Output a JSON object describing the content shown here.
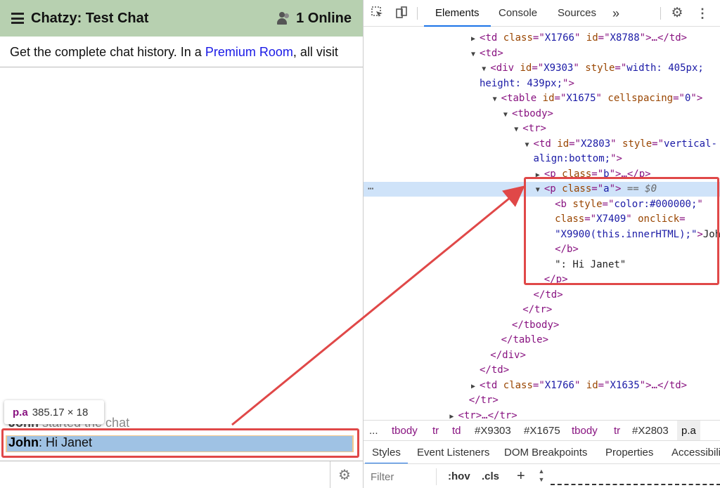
{
  "chat": {
    "title": "Chatzy: Test Chat",
    "online": "1 Online",
    "banner_pre": "Get the complete chat history. In a ",
    "banner_link": "Premium Room",
    "banner_post": ", all visit",
    "tooltip_tag": "p.a",
    "tooltip_size": "385.17 × 18",
    "msg1_user": "John",
    "msg1_text": " started the chat",
    "msg2_user": "John",
    "msg2_text": ": Hi Janet"
  },
  "devtools": {
    "tabs": [
      "Elements",
      "Console",
      "Sources",
      "»"
    ],
    "dom": [
      {
        "indent": 10,
        "tri": "▶",
        "parts": [
          [
            "tag",
            "<td "
          ],
          [
            "attr",
            "class"
          ],
          [
            "tag",
            "=\""
          ],
          [
            "val",
            "X1766"
          ],
          [
            "tag",
            "\" "
          ],
          [
            "attr",
            "id"
          ],
          [
            "tag",
            "=\""
          ],
          [
            "val",
            "X8788"
          ],
          [
            "tag",
            "\">…</td>"
          ]
        ]
      },
      {
        "indent": 10,
        "tri": "▼",
        "parts": [
          [
            "tag",
            "<td>"
          ]
        ]
      },
      {
        "indent": 11,
        "tri": "▼",
        "parts": [
          [
            "tag",
            "<div "
          ],
          [
            "attr",
            "id"
          ],
          [
            "tag",
            "=\""
          ],
          [
            "val",
            "X9303"
          ],
          [
            "tag",
            "\" "
          ],
          [
            "attr",
            "style"
          ],
          [
            "tag",
            "=\""
          ],
          [
            "val",
            "width: 405px;"
          ]
        ]
      },
      {
        "indent": 10,
        "tri": "",
        "parts": [
          [
            "val",
            "height: 439px;"
          ],
          [
            "tag",
            "\">"
          ]
        ]
      },
      {
        "indent": 12,
        "tri": "▼",
        "parts": [
          [
            "tag",
            "<table "
          ],
          [
            "attr",
            "id"
          ],
          [
            "tag",
            "=\""
          ],
          [
            "val",
            "X1675"
          ],
          [
            "tag",
            "\" "
          ],
          [
            "attr",
            "cellspacing"
          ],
          [
            "tag",
            "=\""
          ],
          [
            "val",
            "0"
          ],
          [
            "tag",
            "\">"
          ]
        ]
      },
      {
        "indent": 13,
        "tri": "▼",
        "parts": [
          [
            "tag",
            "<tbody>"
          ]
        ]
      },
      {
        "indent": 14,
        "tri": "▼",
        "parts": [
          [
            "tag",
            "<tr>"
          ]
        ]
      },
      {
        "indent": 15,
        "tri": "▼",
        "parts": [
          [
            "tag",
            "<td "
          ],
          [
            "attr",
            "id"
          ],
          [
            "tag",
            "=\""
          ],
          [
            "val",
            "X2803"
          ],
          [
            "tag",
            "\" "
          ],
          [
            "attr",
            "style"
          ],
          [
            "tag",
            "=\""
          ],
          [
            "val",
            "vertical-"
          ]
        ]
      },
      {
        "indent": 15,
        "tri": "",
        "parts": [
          [
            "val",
            "align:bottom;"
          ],
          [
            "tag",
            "\">"
          ]
        ]
      },
      {
        "indent": 16,
        "tri": "▶",
        "parts": [
          [
            "tag",
            "<p "
          ],
          [
            "attr",
            "class"
          ],
          [
            "tag",
            "=\""
          ],
          [
            "val",
            "b"
          ],
          [
            "tag",
            "\">…</p>"
          ]
        ]
      },
      {
        "indent": 16,
        "tri": "▼",
        "sel": true,
        "parts": [
          [
            "tag",
            "<p "
          ],
          [
            "attr",
            "class"
          ],
          [
            "tag",
            "=\""
          ],
          [
            "val",
            "a"
          ],
          [
            "tag",
            "\">"
          ],
          [
            "eq",
            " == $0"
          ]
        ]
      },
      {
        "indent": 17,
        "tri": "",
        "parts": [
          [
            "tag",
            "<b "
          ],
          [
            "attr",
            "style"
          ],
          [
            "tag",
            "=\""
          ],
          [
            "val",
            "color:#000000;"
          ],
          [
            "tag",
            "\""
          ]
        ]
      },
      {
        "indent": 17,
        "tri": "",
        "parts": [
          [
            "attr",
            "class"
          ],
          [
            "tag",
            "=\""
          ],
          [
            "val",
            "X7409"
          ],
          [
            "tag",
            "\" "
          ],
          [
            "attr",
            "onclick"
          ],
          [
            "tag",
            "="
          ]
        ]
      },
      {
        "indent": 17,
        "tri": "",
        "parts": [
          [
            "val",
            "\"X9900(this.innerHTML);\""
          ],
          [
            "tag",
            ">"
          ],
          [
            "txt",
            "John"
          ]
        ]
      },
      {
        "indent": 17,
        "tri": "",
        "parts": [
          [
            "tag",
            "</b>"
          ]
        ]
      },
      {
        "indent": 17,
        "tri": "",
        "parts": [
          [
            "txt",
            "\": Hi Janet\""
          ]
        ]
      },
      {
        "indent": 16,
        "tri": "",
        "parts": [
          [
            "tag",
            "</p>"
          ]
        ]
      },
      {
        "indent": 15,
        "tri": "",
        "parts": [
          [
            "tag",
            "</td>"
          ]
        ]
      },
      {
        "indent": 14,
        "tri": "",
        "parts": [
          [
            "tag",
            "</tr>"
          ]
        ]
      },
      {
        "indent": 13,
        "tri": "",
        "parts": [
          [
            "tag",
            "</tbody>"
          ]
        ]
      },
      {
        "indent": 12,
        "tri": "",
        "parts": [
          [
            "tag",
            "</table>"
          ]
        ]
      },
      {
        "indent": 11,
        "tri": "",
        "parts": [
          [
            "tag",
            "</div>"
          ]
        ]
      },
      {
        "indent": 10,
        "tri": "",
        "parts": [
          [
            "tag",
            "</td>"
          ]
        ]
      },
      {
        "indent": 10,
        "tri": "▶",
        "parts": [
          [
            "tag",
            "<td "
          ],
          [
            "attr",
            "class"
          ],
          [
            "tag",
            "=\""
          ],
          [
            "val",
            "X1766"
          ],
          [
            "tag",
            "\" "
          ],
          [
            "attr",
            "id"
          ],
          [
            "tag",
            "=\""
          ],
          [
            "val",
            "X1635"
          ],
          [
            "tag",
            "\">…</td>"
          ]
        ]
      },
      {
        "indent": 9,
        "tri": "",
        "parts": [
          [
            "tag",
            "</tr>"
          ]
        ]
      },
      {
        "indent": 8,
        "tri": "▶",
        "parts": [
          [
            "tag",
            "<tr>…</tr>"
          ]
        ]
      }
    ],
    "breadcrumbs": [
      "...",
      "tbody",
      "tr",
      "td",
      "#X9303",
      "#X1675",
      "tbody",
      "tr",
      "#X2803",
      "p.a"
    ],
    "subtabs": [
      "Styles",
      "Event Listeners",
      "DOM Breakpoints",
      "Properties",
      "Accessibility"
    ],
    "filter_placeholder": "Filter",
    "hov": ":hov",
    "cls": ".cls",
    "plus": "+"
  },
  "colors": {
    "header_bg": "#b7d0b0",
    "highlight": "#e04848",
    "link": "#1919e6",
    "selection": "#cfe3f9"
  }
}
